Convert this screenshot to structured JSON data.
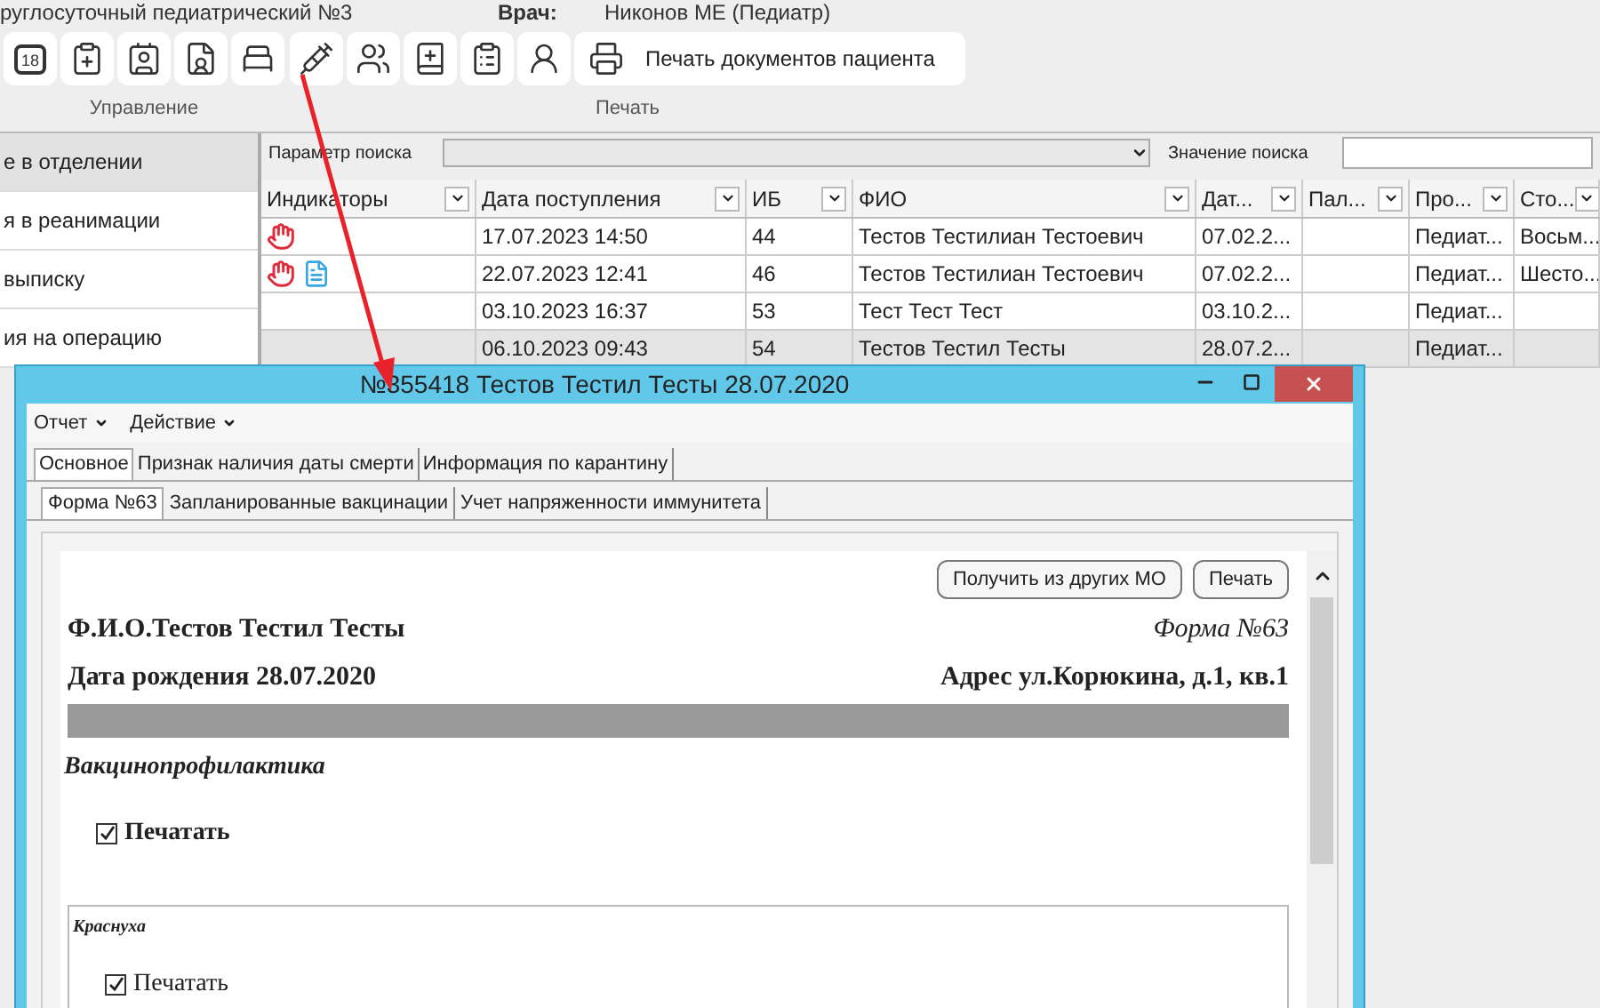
{
  "header": {
    "org": "руглосуточный педиатрический №3",
    "doctor_label": "Врач:",
    "doctor": "Никонов МЕ (Педиатр)"
  },
  "toolbar": [
    {
      "label": "Управление",
      "buttons": [
        {
          "kind": "calendar",
          "text": "18"
        },
        {
          "kind": "clipboard-down"
        },
        {
          "kind": "badge"
        },
        {
          "kind": "doc-person"
        },
        {
          "kind": "bed"
        }
      ]
    },
    {
      "label": "Печать",
      "buttons": [
        {
          "kind": "syringe"
        },
        {
          "kind": "group"
        },
        {
          "kind": "book"
        },
        {
          "kind": "clipboard"
        },
        {
          "kind": "person"
        },
        {
          "kind": "printer",
          "text": "Печать документов пациента"
        }
      ]
    }
  ],
  "sidebar": {
    "items": [
      {
        "label": "е в отделении",
        "selected": true
      },
      {
        "label": "я в реанимации",
        "selected": false
      },
      {
        "label": "выписку",
        "selected": false
      },
      {
        "label": "ия на операцию",
        "selected": false
      }
    ]
  },
  "search": {
    "param_label": "Параметр поиска",
    "value_label": "Значение поиска"
  },
  "table": {
    "indicator_column": "Индикаторы",
    "columns": [
      "Дата поступления",
      "ИБ",
      "ФИО",
      "Дат...",
      "Пал...",
      "Про...",
      "Сто..."
    ],
    "rows": [
      {
        "selected": false,
        "flagged": true,
        "has_document": false,
        "cells": [
          "17.07.2023 14:50",
          "44",
          "Тестов Тестилиан Тестоевич",
          "07.02.2...",
          "",
          "Педиат...",
          "Восьм..."
        ]
      },
      {
        "selected": false,
        "flagged": true,
        "has_document": true,
        "cells": [
          "22.07.2023 12:41",
          "46",
          "Тестов Тестилиан Тестоевич",
          "07.02.2...",
          "",
          "Педиат...",
          "Шесто..."
        ]
      },
      {
        "selected": false,
        "flagged": false,
        "has_document": false,
        "cells": [
          "03.10.2023 16:37",
          "53",
          "Тест Тест Тест",
          "03.10.2...",
          "",
          "Педиат...",
          ""
        ]
      },
      {
        "selected": true,
        "flagged": false,
        "has_document": false,
        "cells": [
          "06.10.2023 09:43",
          "54",
          "Тестов Тестил Тесты",
          "28.07.2...",
          "",
          "Педиат...",
          ""
        ]
      }
    ]
  },
  "dialog": {
    "title": "№355418 Тестов Тестил Тесты 28.07.2020",
    "menu": [
      "Отчет",
      "Действие"
    ],
    "tabs": [
      {
        "label": "Основное",
        "selected": true
      },
      {
        "label": "Признак наличия даты смерти",
        "selected": false
      },
      {
        "label": "Информация по карантину",
        "selected": false
      }
    ],
    "subtabs": [
      {
        "label": "Форма №63",
        "selected": true
      },
      {
        "label": "Запланированные вакцинации",
        "selected": false
      },
      {
        "label": "Учет напряженности иммунитета",
        "selected": false
      }
    ],
    "buttons": [
      "Получить из других МО",
      "Печать"
    ],
    "form": {
      "name": "Ф.И.О.Тестов Тестил Тесты",
      "form_no": "Форма №63",
      "birth": "Дата рождения 28.07.2020",
      "address": "Адрес ул.Корюкина, д.1, кв.1",
      "section": "Вакцинопрофилактика",
      "print": {
        "label": "Печатать",
        "checked": true
      },
      "group": {
        "title": "Краснуха",
        "print": {
          "label": "Печатать",
          "checked": true
        }
      }
    }
  }
}
